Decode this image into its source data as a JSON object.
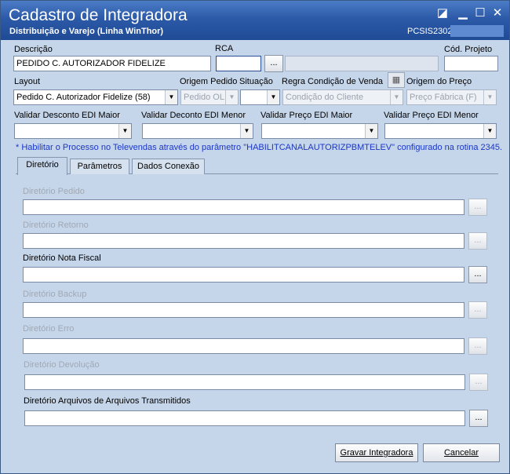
{
  "window": {
    "title": "Cadastro de Integradora",
    "subtitle": "Distribuição e Varejo (Linha WinThor)",
    "code": "PCSIS2302"
  },
  "fields": {
    "descricao": {
      "label": "Descrição",
      "value": "PEDIDO C. AUTORIZADOR FIDELIZE"
    },
    "rca": {
      "label": "RCA",
      "value": "",
      "ellipsis": "..."
    },
    "cod_projeto": {
      "label": "Cód. Projeto",
      "value": ""
    },
    "layout": {
      "label": "Layout",
      "value": "Pedido C. Autorizador Fidelize (58)"
    },
    "origem_pedido": {
      "label": "Origem Pedido",
      "value": "Pedido OL"
    },
    "situacao": {
      "label": "Situação",
      "value": ""
    },
    "regra_condicao": {
      "label": "Regra Condição de Venda",
      "value": "Condição do Cliente"
    },
    "origem_preco": {
      "label": "Origem do Preço",
      "value": "Preço Fábrica (F)"
    },
    "validar_desc_maior": {
      "label": "Validar Desconto EDI Maior",
      "value": ""
    },
    "validar_desc_menor": {
      "label": "Validar Deconto EDI Menor",
      "value": ""
    },
    "validar_preco_maior": {
      "label": "Validar Preço EDI Maior",
      "value": ""
    },
    "validar_preco_menor": {
      "label": "Validar Preço EDI Menor",
      "value": ""
    }
  },
  "hint": "* Habilitar o Processo no Televendas através do parâmetro \"HABILITCANALAUTORIZPBMTELEV\" configurado na rotina 2345.",
  "tabs": [
    "Diretório",
    "Parâmetros",
    "Dados Conexão"
  ],
  "directories": [
    {
      "label": "Diretório Pedido",
      "value": "",
      "button": "..."
    },
    {
      "label": "Diretório Retorno",
      "value": "",
      "button": "..."
    },
    {
      "label": "Diretório Nota Fiscal",
      "value": "",
      "button": "..."
    },
    {
      "label": "Diretório Backup",
      "value": "",
      "button": "..."
    },
    {
      "label": "Diretório Erro",
      "value": "",
      "button": "..."
    },
    {
      "label": "Diretório Devolução",
      "value": "",
      "button": "..."
    },
    {
      "label": "Diretório Arquivos de Arquivos Transmitidos",
      "value": "",
      "button": "..."
    }
  ],
  "buttons": {
    "save": "Gravar Integradora",
    "cancel": "Cancelar"
  }
}
